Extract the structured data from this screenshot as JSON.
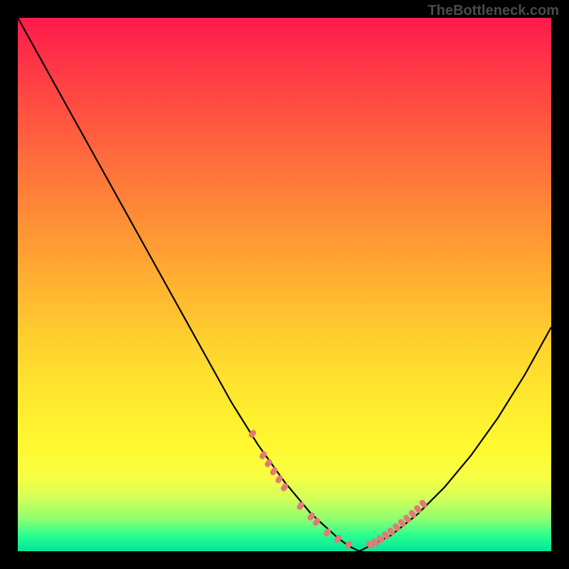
{
  "watermark": "TheBottleneck.com",
  "chart_data": {
    "type": "line",
    "title": "",
    "xlabel": "",
    "ylabel": "",
    "xlim": [
      0,
      100
    ],
    "ylim": [
      0,
      100
    ],
    "series": [
      {
        "name": "bottleneck-curve",
        "x": [
          0,
          5,
          10,
          15,
          20,
          25,
          30,
          35,
          40,
          45,
          50,
          55,
          60,
          62,
          64,
          66,
          70,
          75,
          80,
          85,
          90,
          95,
          100
        ],
        "values": [
          100,
          91,
          82,
          73,
          64,
          55,
          46,
          37,
          28,
          20,
          13,
          7,
          2.5,
          1,
          0,
          1,
          3,
          7,
          12,
          18,
          25,
          33,
          42
        ]
      }
    ],
    "marker_clusters": [
      {
        "name": "left-cluster",
        "x": [
          44,
          46,
          47,
          48,
          49,
          50,
          53,
          55,
          56,
          58,
          60,
          62
        ],
        "values": [
          22,
          18,
          16.5,
          15,
          13.5,
          12,
          8.5,
          6.5,
          5.5,
          3.5,
          2.3,
          1.2
        ]
      },
      {
        "name": "right-cluster",
        "x": [
          66,
          67,
          68,
          69,
          70,
          71,
          72,
          73,
          74,
          75,
          76
        ],
        "values": [
          1.2,
          1.7,
          2.3,
          3.0,
          3.7,
          4.5,
          5.3,
          6.1,
          7.0,
          7.9,
          8.9
        ]
      }
    ],
    "colors": {
      "curve": "#000000",
      "marker": "#e37a78",
      "background_top": "#ff1a4d",
      "background_bottom": "#00e59b"
    }
  }
}
